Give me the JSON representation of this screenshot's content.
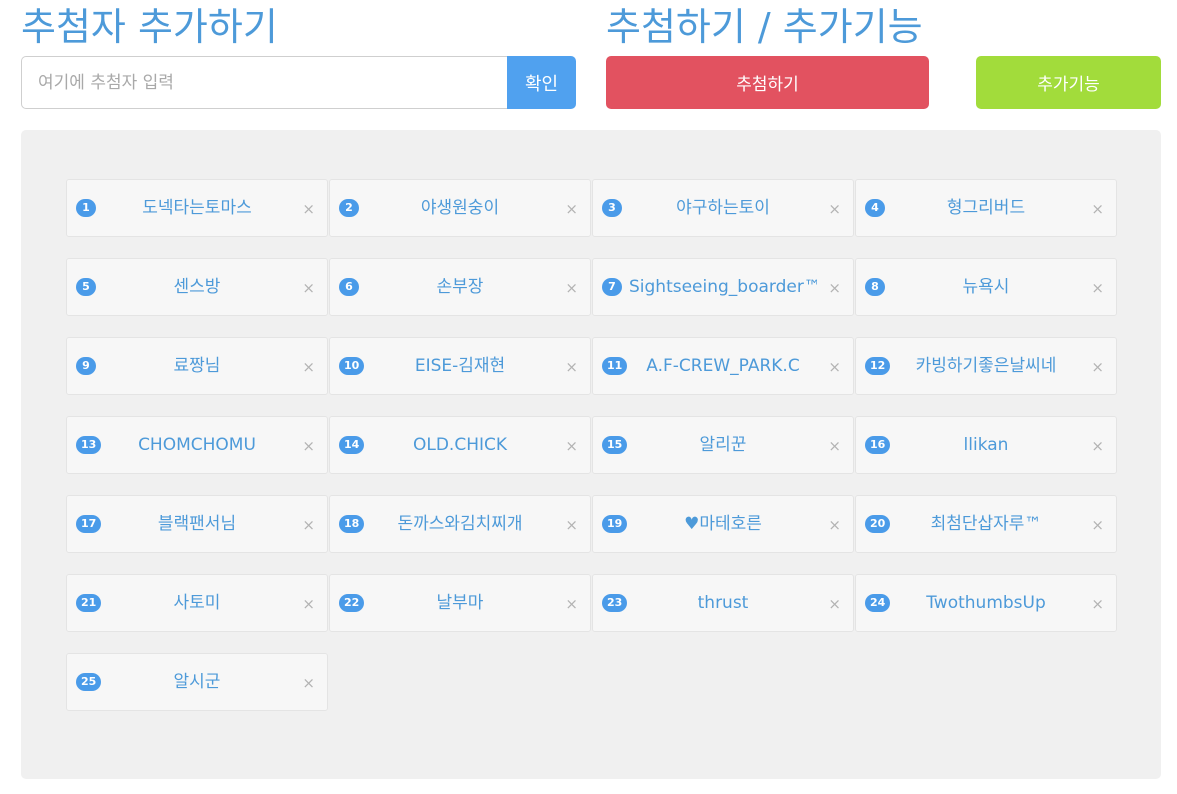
{
  "headings": {
    "add": "추첨자 추가하기",
    "draw": "추첨하기 / 추가기능"
  },
  "add_form": {
    "placeholder": "여기에 추첨자 입력",
    "value": "",
    "confirm_label": "확인"
  },
  "actions": {
    "draw_label": "추첨하기",
    "extra_label": "추가기능"
  },
  "remove_glyph": "×",
  "colors": {
    "heading": "#4d9ad9",
    "confirm": "#50a1ef",
    "draw": "#e25260",
    "extra": "#a2dc3b",
    "badge": "#4a9be9",
    "panel": "#f0f0f0"
  },
  "participants": [
    {
      "num": "1",
      "name": "도넥타는토마스"
    },
    {
      "num": "2",
      "name": "야생원숭이"
    },
    {
      "num": "3",
      "name": "야구하는토이"
    },
    {
      "num": "4",
      "name": "형그리버드"
    },
    {
      "num": "5",
      "name": "센스방"
    },
    {
      "num": "6",
      "name": "손부장"
    },
    {
      "num": "7",
      "name": "Sightseeing_boarder™"
    },
    {
      "num": "8",
      "name": "뉴욕시"
    },
    {
      "num": "9",
      "name": "료짱님"
    },
    {
      "num": "10",
      "name": "EISE-김재현"
    },
    {
      "num": "11",
      "name": "A.F-CREW_PARK.C"
    },
    {
      "num": "12",
      "name": "카빙하기좋은날씨네"
    },
    {
      "num": "13",
      "name": "CHOMCHOMU"
    },
    {
      "num": "14",
      "name": "OLD.CHICK"
    },
    {
      "num": "15",
      "name": "알리꾼"
    },
    {
      "num": "16",
      "name": "llikan"
    },
    {
      "num": "17",
      "name": "블랙팬서님"
    },
    {
      "num": "18",
      "name": "돈까스와김치찌개"
    },
    {
      "num": "19",
      "name": "♥마테호른"
    },
    {
      "num": "20",
      "name": "최첨단삽자루™"
    },
    {
      "num": "21",
      "name": "사토미"
    },
    {
      "num": "22",
      "name": "날부마"
    },
    {
      "num": "23",
      "name": "thrust"
    },
    {
      "num": "24",
      "name": "TwothumbsUp"
    },
    {
      "num": "25",
      "name": "알시군"
    }
  ]
}
